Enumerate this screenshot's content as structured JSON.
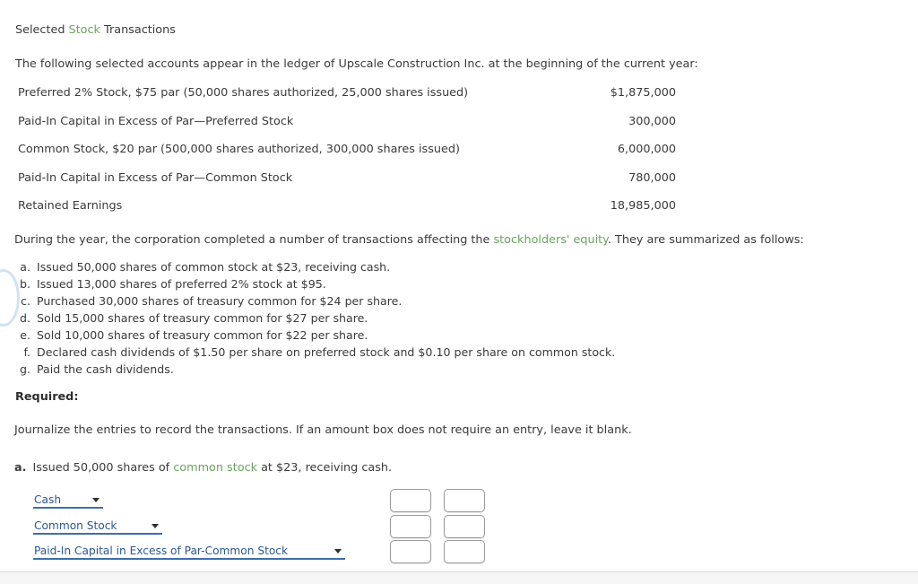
{
  "title": {
    "prefix": "Selected ",
    "highlight": "Stock",
    "suffix": " Transactions"
  },
  "intro": "The following selected accounts appear in the ledger of Upscale Construction Inc. at the beginning of the current year:",
  "accounts": [
    {
      "name": "Preferred 2% Stock, $75 par (50,000 shares authorized, 25,000 shares issued)",
      "value": "$1,875,000"
    },
    {
      "name": "Paid-In Capital in Excess of Par—Preferred Stock",
      "value": "300,000"
    },
    {
      "name": "Common Stock, $20 par (500,000 shares authorized, 300,000 shares issued)",
      "value": "6,000,000"
    },
    {
      "name": "Paid-In Capital in Excess of Par—Common Stock",
      "value": "780,000"
    },
    {
      "name": "Retained Earnings",
      "value": "18,985,000"
    }
  ],
  "during": {
    "prefix": "During the year, the corporation completed a number of transactions affecting the ",
    "highlight": "stockholders' equity",
    "suffix": ". They are summarized as follows:"
  },
  "transactions": [
    {
      "letter": "a.",
      "text": "Issued 50,000 shares of common stock at $23, receiving cash."
    },
    {
      "letter": "b.",
      "text": "Issued 13,000 shares of preferred 2% stock at $95."
    },
    {
      "letter": "c.",
      "text": "Purchased 30,000 shares of treasury common for $24 per share."
    },
    {
      "letter": "d.",
      "text": "Sold 15,000 shares of treasury common for $27 per share."
    },
    {
      "letter": "e.",
      "text": "Sold 10,000 shares of treasury common for $22 per share."
    },
    {
      "letter": "f.",
      "text": "Declared cash dividends of $1.50 per share on preferred stock and $0.10 per share on common stock."
    },
    {
      "letter": "g.",
      "text": "Paid the cash dividends."
    }
  ],
  "required": {
    "label": "Required:",
    "text": "Journalize the entries to record the transactions. If an amount box does not require an entry, leave it blank."
  },
  "part_a": {
    "letter": "a.",
    "prefix": "Issued 50,000 shares of ",
    "highlight": "common stock",
    "suffix": " at $23, receiving cash."
  },
  "journal": {
    "rows": [
      {
        "account": "Cash",
        "debit": "",
        "credit": ""
      },
      {
        "account": "Common Stock",
        "debit": "",
        "credit": ""
      },
      {
        "account": "Paid-In Capital in Excess of Par-Common Stock",
        "debit": "",
        "credit": ""
      }
    ]
  },
  "colors": {
    "highlight_green": "#6aa45f",
    "select_blue": "#2b5897",
    "select_underline": "#3f6ea8",
    "text": "#3a3a3a"
  }
}
